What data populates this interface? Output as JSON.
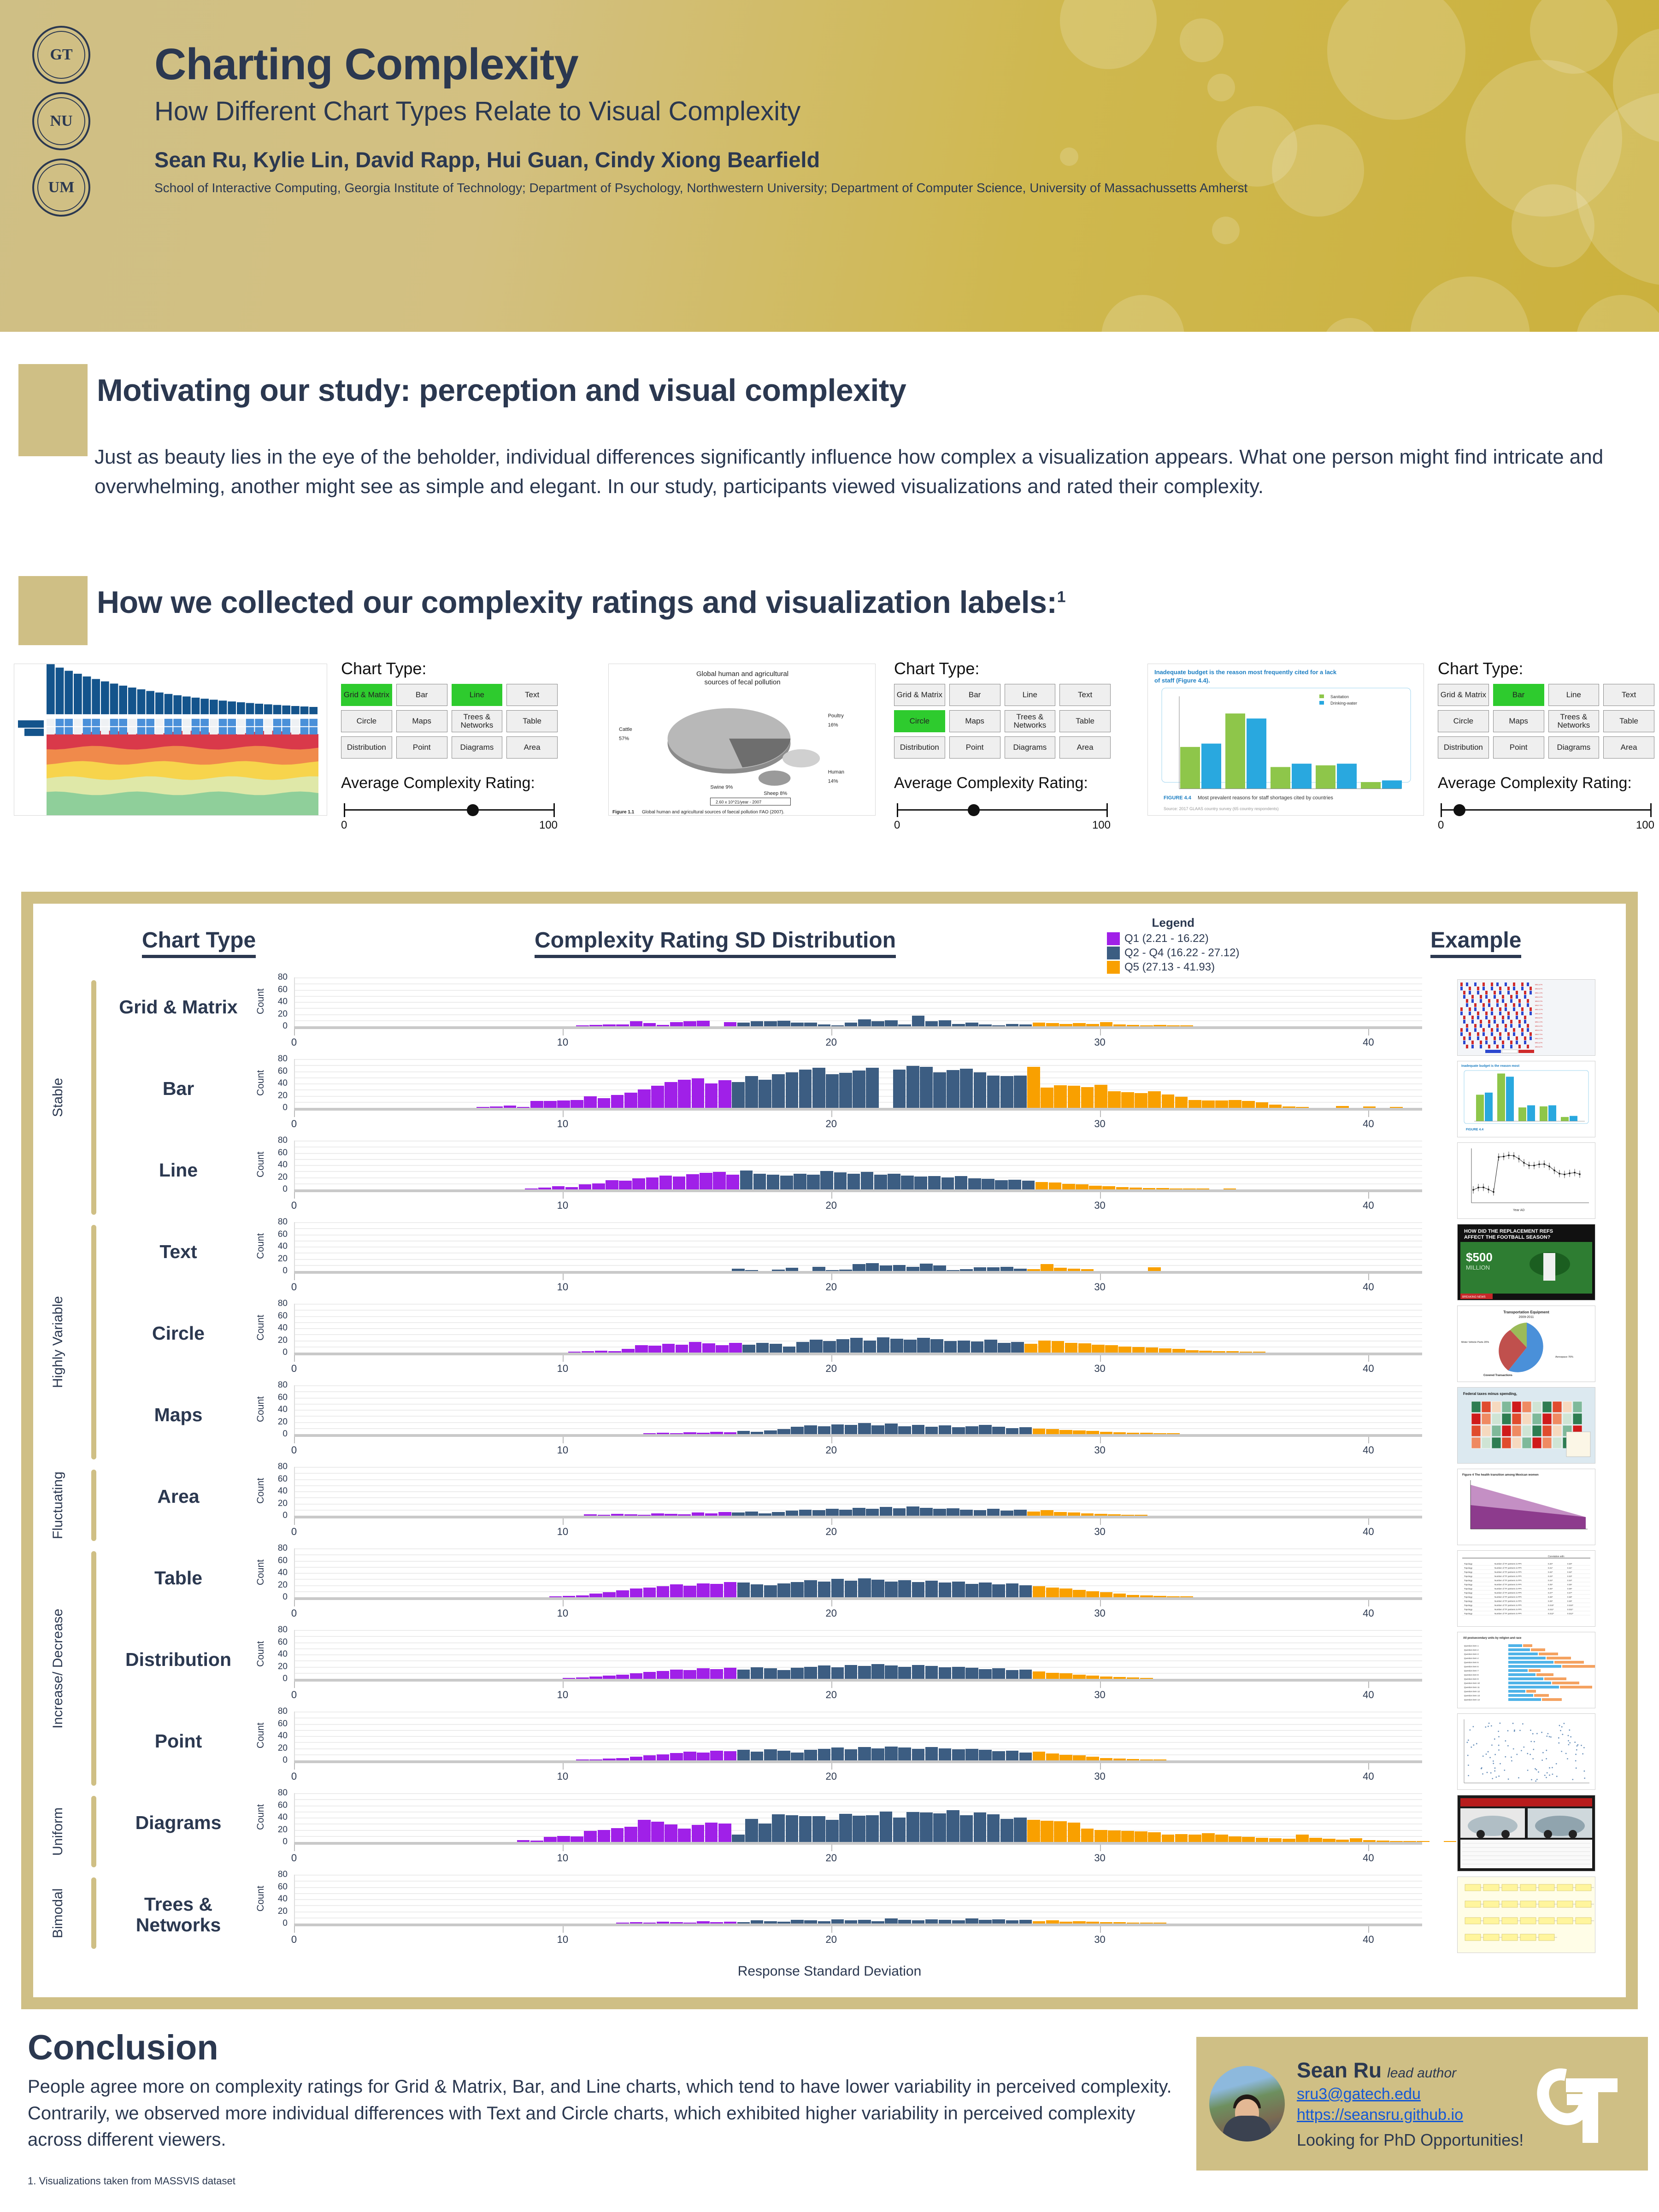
{
  "header": {
    "title": "Charting Complexity",
    "subtitle": "How Different Chart Types Relate to Visual Complexity",
    "authors": "Sean Ru, Kylie Lin, David Rapp, Hui Guan, Cindy Xiong Bearfield",
    "affiliations": "School of Interactive Computing, Georgia Institute of Technology; Department of Psychology, Northwestern University; Department of Computer Science, University of Massachussetts Amherst",
    "seals": [
      "Georgia Institute of Technology",
      "Northwestern University",
      "University of Massachusetts"
    ],
    "bg_color": "#cfb84f"
  },
  "sections": {
    "motivation": {
      "title": "Motivating our study: perception and visual complexity",
      "body": "Just as beauty lies in the eye of the beholder, individual differences significantly influence how complex a visualization appears. What one person might find intricate and overwhelming, another might see as simple and elegant. In our study, participants viewed visualizations and rated their complexity."
    },
    "method": {
      "title": "How we collected our complexity ratings and visualization labels:",
      "title_superscript": "1"
    }
  },
  "method_examples": [
    {
      "thumb_name": "mutation-genomics-stacked-chart",
      "chart_type_label": "Chart Type:",
      "rating_label": "Average Complexity Rating:",
      "selected": [
        "Grid & Matrix",
        "Line"
      ],
      "rating_value": 62,
      "scale_min": "0",
      "scale_max": "100"
    },
    {
      "thumb_name": "fecal-pollution-pie-chart",
      "chart_type_label": "Chart Type:",
      "rating_label": "Average Complexity Rating:",
      "selected": [
        "Circle"
      ],
      "rating_value": 37,
      "scale_min": "0",
      "scale_max": "100"
    },
    {
      "thumb_name": "staff-shortage-bar-chart",
      "chart_type_label": "Chart Type:",
      "rating_label": "Average Complexity Rating:",
      "selected": [
        "Bar"
      ],
      "rating_value": 9,
      "scale_min": "0",
      "scale_max": "100"
    }
  ],
  "chart_type_buttons": [
    "Grid & Matrix",
    "Bar",
    "Line",
    "Text",
    "Circle",
    "Maps",
    "Trees & Networks",
    "Table",
    "Distribution",
    "Point",
    "Diagrams",
    "Area"
  ],
  "figure": {
    "col_headers": {
      "left": "Chart Type",
      "center": "Complexity Rating SD Distribution",
      "right": "Example"
    },
    "legend_title": "Legend",
    "legend": [
      {
        "label": "Q1 (2.21 - 16.22)",
        "color": "#a020e8"
      },
      {
        "label": "Q2 - Q4 (16.22 - 27.12)",
        "color": "#3c5d82"
      },
      {
        "label": "Q5 (27.13 - 41.93)",
        "color": "#f9a000"
      }
    ],
    "groups": [
      {
        "label": "Stable",
        "rows": 3
      },
      {
        "label": "Highly Variable",
        "rows": 3
      },
      {
        "label": "Fluctuating",
        "rows": 1
      },
      {
        "label": "Increase/ Decrease",
        "rows": 3
      },
      {
        "label": "Uniform",
        "rows": 1
      },
      {
        "label": "Bimodal",
        "rows": 1
      }
    ],
    "row_examples": [
      "heatmap-dendrogram-cna",
      "staff-shortage-grouped-bar",
      "carbon-14-line-chart",
      "replacement-refs-infographic",
      "transportation-equipment-pie",
      "federal-taxes-choropleth-map",
      "mexican-women-death-area-chart",
      "correlation-data-table",
      "survey-distribution-chart",
      "scatter-point-plot",
      "car-comparison-diagram",
      "network-tree-diagram"
    ]
  },
  "chart_data": {
    "type": "bar",
    "title": "Complexity Rating SD Distribution",
    "xlabel": "Response Standard Deviation",
    "ylabel": "Count",
    "xlim": [
      0,
      42
    ],
    "ylim": [
      0,
      80
    ],
    "yticks": [
      0,
      20,
      40,
      60,
      80
    ],
    "xticks": [
      0,
      10,
      20,
      30,
      40
    ],
    "bin_width": 0.5,
    "grid": true,
    "legend_position": "top-right",
    "color_bands": {
      "q1": {
        "range": [
          2.21,
          16.22
        ],
        "color": "#a020e8"
      },
      "q2_q4": {
        "range": [
          16.22,
          27.12
        ],
        "color": "#3c5d82"
      },
      "q5": {
        "range": [
          27.13,
          41.93
        ],
        "color": "#f9a000"
      }
    },
    "panels": [
      {
        "name": "Grid & Matrix",
        "group": "Stable",
        "x_start": 10.5,
        "values": [
          1,
          2,
          3,
          3,
          8,
          5,
          2,
          7,
          8,
          9,
          0,
          7,
          6,
          8,
          8,
          9,
          6,
          6,
          3,
          1,
          6,
          11,
          8,
          10,
          3,
          17,
          8,
          10,
          4,
          6,
          3,
          1,
          4,
          3,
          6,
          5,
          4,
          5,
          4,
          7,
          3,
          2,
          1,
          2,
          1,
          1,
          0,
          0,
          0,
          0
        ]
      },
      {
        "name": "Bar",
        "group": "Stable",
        "x_start": 6.8,
        "values": [
          1,
          2,
          4,
          1,
          11,
          11,
          12,
          13,
          19,
          16,
          21,
          25,
          30,
          36,
          42,
          46,
          48,
          40,
          45,
          42,
          52,
          46,
          55,
          58,
          63,
          66,
          55,
          57,
          61,
          66,
          0,
          63,
          69,
          67,
          58,
          62,
          64,
          58,
          53,
          52,
          53,
          67,
          33,
          37,
          36,
          34,
          38,
          27,
          26,
          24,
          27,
          22,
          18,
          13,
          12,
          12,
          13,
          11,
          9,
          5,
          2,
          1,
          0,
          0,
          3,
          0,
          2,
          0,
          1
        ]
      },
      {
        "name": "Line",
        "group": "Stable",
        "x_start": 8.6,
        "values": [
          1,
          3,
          5,
          4,
          8,
          10,
          15,
          14,
          18,
          20,
          23,
          21,
          25,
          27,
          29,
          24,
          31,
          26,
          24,
          23,
          26,
          24,
          30,
          28,
          26,
          29,
          24,
          26,
          23,
          21,
          22,
          20,
          22,
          18,
          17,
          15,
          16,
          14,
          12,
          11,
          9,
          8,
          6,
          5,
          4,
          3,
          2,
          2,
          1,
          1,
          1,
          0,
          1
        ]
      },
      {
        "name": "Text",
        "group": "Highly Variable",
        "x_start": 16.3,
        "values": [
          4,
          1,
          0,
          2,
          5,
          0,
          7,
          1,
          2,
          11,
          13,
          9,
          10,
          7,
          12,
          9,
          1,
          3,
          6,
          6,
          7,
          4,
          3,
          11,
          5,
          4,
          3,
          0,
          0,
          0,
          0,
          6,
          0,
          0,
          0,
          0
        ]
      },
      {
        "name": "Circle",
        "group": "Highly Variable",
        "x_start": 10.2,
        "values": [
          1,
          2,
          3,
          2,
          6,
          12,
          11,
          14,
          13,
          17,
          15,
          12,
          16,
          13,
          16,
          14,
          10,
          17,
          21,
          19,
          22,
          24,
          20,
          25,
          23,
          21,
          24,
          22,
          19,
          20,
          18,
          21,
          16,
          17,
          14,
          20,
          19,
          16,
          15,
          13,
          12,
          10,
          9,
          8,
          7,
          6,
          4,
          3,
          2,
          2,
          1,
          1
        ]
      },
      {
        "name": "Maps",
        "group": "Highly Variable",
        "x_start": 13.0,
        "values": [
          1,
          2,
          1,
          3,
          2,
          4,
          3,
          5,
          4,
          6,
          8,
          12,
          14,
          13,
          16,
          15,
          18,
          14,
          17,
          13,
          15,
          12,
          14,
          11,
          13,
          15,
          12,
          10,
          11,
          9,
          8,
          7,
          6,
          5,
          4,
          3,
          2,
          2,
          1,
          1
        ]
      },
      {
        "name": "Area",
        "group": "Fluctuating",
        "x_start": 10.8,
        "values": [
          2,
          1,
          3,
          2,
          1,
          4,
          3,
          2,
          5,
          4,
          6,
          5,
          7,
          4,
          6,
          8,
          10,
          9,
          11,
          10,
          13,
          11,
          14,
          12,
          15,
          13,
          11,
          12,
          10,
          9,
          11,
          8,
          10,
          7,
          9,
          6,
          5,
          4,
          3,
          2,
          1,
          1
        ]
      },
      {
        "name": "Table",
        "group": "Increase/ Decrease",
        "x_start": 9.5,
        "values": [
          1,
          2,
          3,
          6,
          8,
          11,
          14,
          16,
          18,
          21,
          19,
          23,
          22,
          25,
          24,
          21,
          20,
          23,
          25,
          28,
          26,
          30,
          27,
          31,
          29,
          26,
          28,
          25,
          27,
          24,
          26,
          22,
          24,
          21,
          23,
          20,
          18,
          16,
          14,
          12,
          10,
          8,
          6,
          4,
          3,
          2,
          1,
          1
        ]
      },
      {
        "name": "Distribution",
        "group": "Increase/ Decrease",
        "x_start": 10.0,
        "values": [
          1,
          2,
          4,
          5,
          7,
          9,
          11,
          13,
          15,
          14,
          17,
          16,
          18,
          15,
          19,
          17,
          14,
          18,
          20,
          22,
          19,
          23,
          21,
          24,
          22,
          20,
          23,
          21,
          19,
          20,
          18,
          16,
          17,
          14,
          15,
          12,
          10,
          9,
          7,
          5,
          4,
          3,
          2,
          1
        ]
      },
      {
        "name": "Point",
        "group": "Increase/ Decrease",
        "x_start": 10.5,
        "values": [
          1,
          1,
          3,
          4,
          6,
          8,
          10,
          12,
          14,
          13,
          16,
          15,
          17,
          14,
          18,
          16,
          13,
          17,
          19,
          21,
          18,
          22,
          20,
          23,
          21,
          19,
          22,
          20,
          18,
          19,
          17,
          15,
          16,
          13,
          14,
          11,
          9,
          8,
          6,
          4,
          3,
          2,
          1,
          1
        ]
      },
      {
        "name": "Diagrams",
        "group": "Uniform",
        "x_start": 8.3,
        "values": [
          3,
          2,
          8,
          10,
          9,
          18,
          20,
          23,
          25,
          36,
          33,
          29,
          22,
          28,
          32,
          30,
          12,
          38,
          30,
          45,
          44,
          42,
          42,
          36,
          46,
          43,
          44,
          50,
          40,
          49,
          48,
          47,
          52,
          44,
          48,
          45,
          38,
          40,
          36,
          35,
          34,
          32,
          22,
          20,
          19,
          18,
          17,
          16,
          12,
          13,
          12,
          14,
          12,
          9,
          8,
          7,
          6,
          5,
          12,
          7,
          5,
          4,
          6,
          3,
          2,
          1,
          1,
          1,
          0,
          1,
          0,
          1
        ]
      },
      {
        "name": "Trees & Networks",
        "group": "Bimodal",
        "x_start": 12.0,
        "values": [
          1,
          2,
          1,
          3,
          2,
          1,
          4,
          2,
          3,
          2,
          5,
          4,
          3,
          6,
          5,
          4,
          7,
          5,
          6,
          4,
          8,
          6,
          5,
          7,
          6,
          5,
          8,
          6,
          7,
          5,
          6,
          4,
          5,
          3,
          4,
          3,
          2,
          2,
          1,
          1,
          1
        ]
      }
    ]
  },
  "conclusion": {
    "title": "Conclusion",
    "body": "People agree more on complexity ratings for Grid & Matrix, Bar, and Line charts, which tend to have lower variability in perceived complexity. Contrarily, we observed more individual differences with Text and Circle charts, which exhibited higher variability in perceived complexity across different viewers.",
    "footnote": "1. Visualizations taken from MASSVIS dataset"
  },
  "author_card": {
    "name": "Sean Ru",
    "role": "lead author",
    "email": "sru3@gatech.edu",
    "website": "https://seansru.github.io",
    "cta": "Looking for PhD Opportunities!",
    "logo": "georgia-tech-gt-logo"
  }
}
